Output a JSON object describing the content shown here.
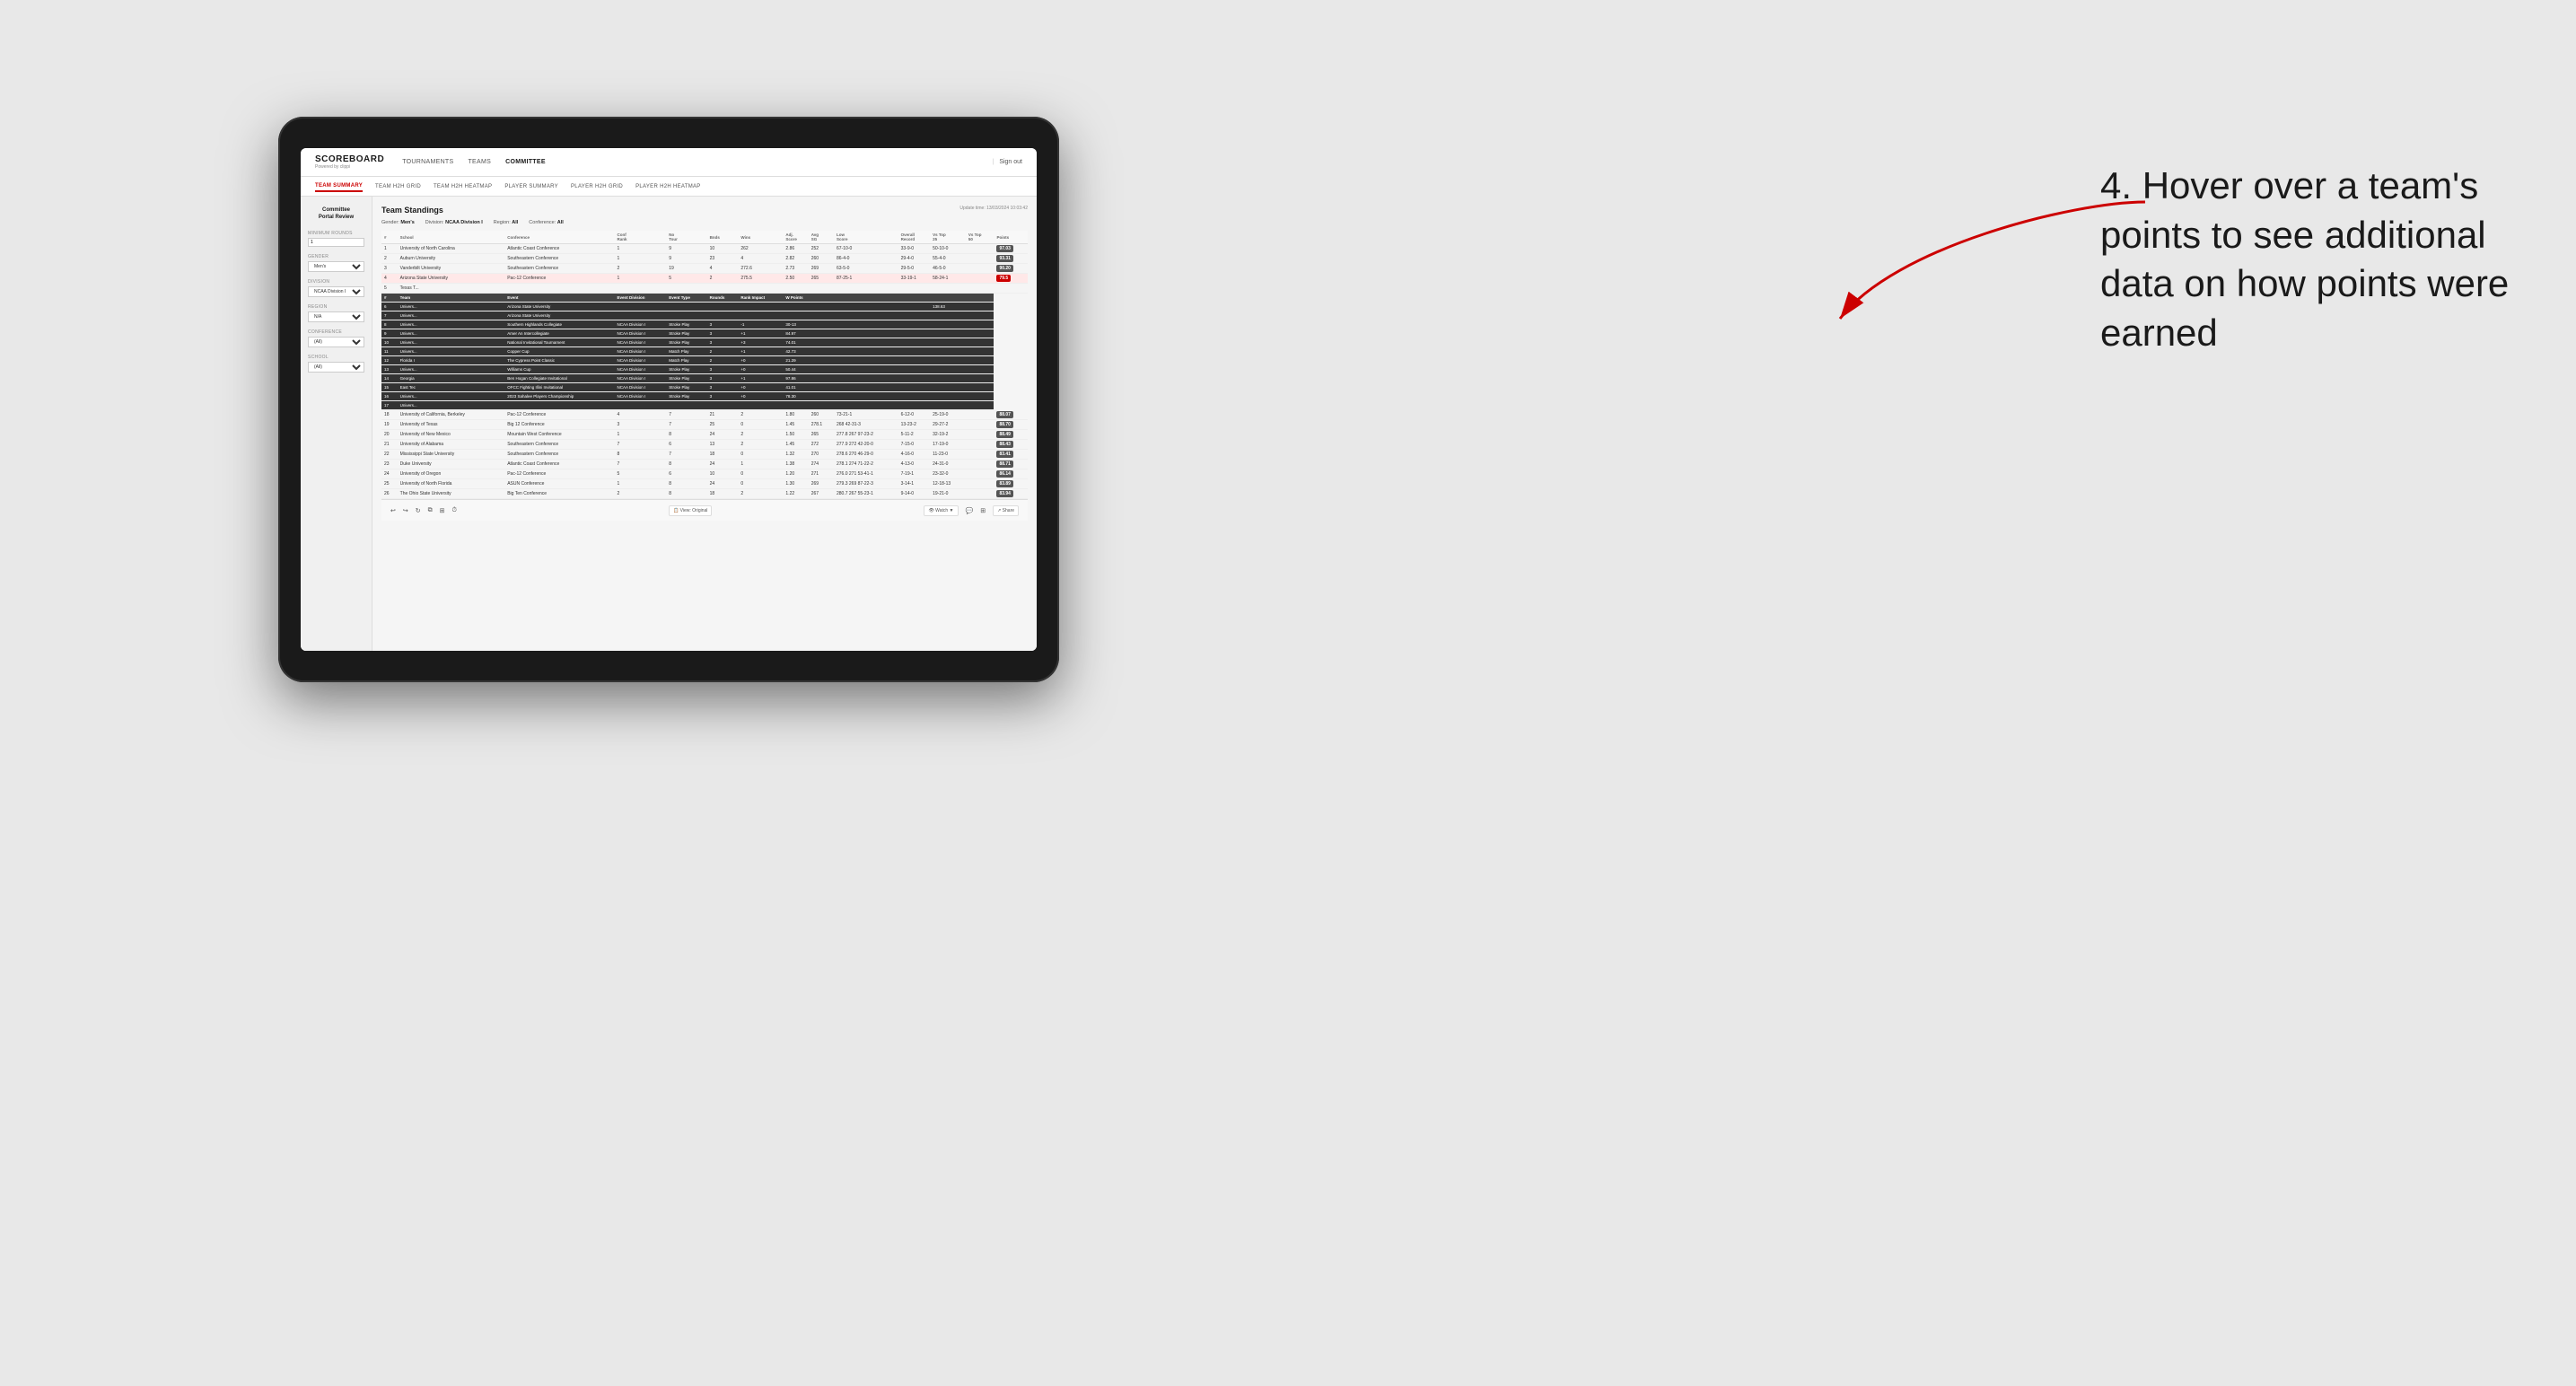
{
  "background": "#e8e8e8",
  "annotation": {
    "text": "4. Hover over a team's points to see additional data on how points were earned"
  },
  "app": {
    "logo": "SCOREBOARD",
    "logo_sub": "Powered by clippi",
    "nav": [
      {
        "label": "TOURNAMENTS",
        "active": false
      },
      {
        "label": "TEAMS",
        "active": false
      },
      {
        "label": "COMMITTEE",
        "active": true
      }
    ],
    "sign_out": "Sign out"
  },
  "sub_nav": [
    {
      "label": "TEAM SUMMARY",
      "active": true
    },
    {
      "label": "TEAM H2H GRID",
      "active": false
    },
    {
      "label": "TEAM H2H HEATMAP",
      "active": false
    },
    {
      "label": "PLAYER SUMMARY",
      "active": false
    },
    {
      "label": "PLAYER H2H GRID",
      "active": false
    },
    {
      "label": "PLAYER H2H HEATMAP",
      "active": false
    }
  ],
  "sidebar": {
    "title": "Committee\nPortal Review",
    "sections": [
      {
        "label": "Minimum Rounds",
        "type": "input",
        "value": "1"
      },
      {
        "label": "Gender",
        "type": "select",
        "value": "Men's"
      },
      {
        "label": "Division",
        "type": "select",
        "value": "NCAA Division I"
      },
      {
        "label": "Region",
        "type": "select",
        "value": "N/A"
      },
      {
        "label": "Conference",
        "type": "select",
        "value": "(All)"
      },
      {
        "label": "School",
        "type": "select",
        "value": "(All)"
      }
    ]
  },
  "content": {
    "title": "Team Standings",
    "update_time": "Update time: 13/03/2024 10:03:42",
    "filters": {
      "gender": "Men's",
      "division": "NCAA Division I",
      "region": "All",
      "conference": "All"
    },
    "table_headers": [
      "#",
      "School",
      "Conference",
      "Conf Rank",
      "No Tour",
      "Bnds Wins",
      "Adj Score",
      "Avg SG",
      "Low Score",
      "Overall Record",
      "Vs Top 25",
      "Vs Top 50",
      "Points"
    ],
    "tooltip_headers": [
      "#",
      "Team",
      "Event",
      "Event Division",
      "Event Type",
      "Rounds",
      "Rank Impact",
      "W Points"
    ],
    "teams": [
      {
        "rank": 1,
        "school": "University of North Carolina",
        "conference": "Atlantic Coast Conference",
        "conf_rank": 1,
        "no_tour": 9,
        "bnds": 10,
        "wins": 262,
        "adj_score": 2.86,
        "avg_sg": 252,
        "low": "67-10-0",
        "overall": "33-9-0",
        "vs25": "50-10-0",
        "vs50": "97.03",
        "points": "97.03",
        "highlighted": false
      },
      {
        "rank": 2,
        "school": "Auburn University",
        "conference": "Southeastern Conference",
        "conf_rank": 1,
        "no_tour": 9,
        "bnds": 23,
        "wins": 4,
        "adj_score": 2.82,
        "avg_sg": 260,
        "low": "86-4-0",
        "overall": "29-4-0",
        "vs25": "55-4-0",
        "vs50": "93.31",
        "points": "93.31",
        "highlighted": false
      },
      {
        "rank": 3,
        "school": "Vanderbilt University",
        "conference": "Southeastern Conference",
        "conf_rank": 2,
        "no_tour": 19,
        "bnds": 4,
        "wins": 272.6,
        "adj_score": 2.73,
        "avg_sg": 269,
        "low": "63-5-0",
        "overall": "29-5-0",
        "vs25": "46-5-0",
        "vs50": "90.20",
        "points": "90.20",
        "highlighted": false
      },
      {
        "rank": 4,
        "school": "Arizona State University",
        "conference": "Pac-12 Conference",
        "conf_rank": 1,
        "no_tour": 5,
        "bnds": 2,
        "wins": 275.5,
        "adj_score": 2.5,
        "avg_sg": 265,
        "low": "87-25-1",
        "overall": "33-19-1",
        "vs25": "58-24-1",
        "vs50": "79.5",
        "points": "79.5",
        "highlighted": true
      },
      {
        "rank": 5,
        "school": "Texas T...",
        "conference": "",
        "conf_rank": "",
        "no_tour": "",
        "bnds": "",
        "wins": "",
        "adj_score": "",
        "avg_sg": "",
        "low": "",
        "overall": "",
        "vs25": "",
        "vs50": "",
        "points": "",
        "highlighted": false
      }
    ],
    "tooltip_rows": [
      {
        "rank": 6,
        "team": "Univers...",
        "event": "Arizona State University",
        "event_division": "",
        "event_type": "",
        "rounds": "",
        "rank_impact": "",
        "w_points": ""
      },
      {
        "rank": 7,
        "team": "Univers...",
        "event": "Arizona State University",
        "event_division": "",
        "event_type": "",
        "rounds": "",
        "rank_impact": "",
        "w_points": ""
      },
      {
        "rank": 8,
        "team": "Univers...",
        "event": "Southern Highlands Collegiate",
        "event_division": "NCAA Division I",
        "event_type": "Stroke Play",
        "rounds": "3",
        "rank_impact": "-1",
        "w_points": "30-13"
      },
      {
        "rank": 9,
        "team": "Univers...",
        "event": "Amer An Intercollegiate",
        "event_division": "NCAA Division I",
        "event_type": "Stroke Play",
        "rounds": "3",
        "rank_impact": "+1",
        "w_points": "84.97"
      },
      {
        "rank": 10,
        "team": "Univers...",
        "event": "National Invitational Tournament",
        "event_division": "NCAA Division I",
        "event_type": "Stroke Play",
        "rounds": "3",
        "rank_impact": "+3",
        "w_points": "74.01"
      },
      {
        "rank": 11,
        "team": "Univers...",
        "event": "Copper Cup",
        "event_division": "NCAA Division I",
        "event_type": "Match Play",
        "rounds": "2",
        "rank_impact": "+1",
        "w_points": "42.73"
      },
      {
        "rank": 12,
        "team": "Florida I",
        "event": "The Cypress Point Classic",
        "event_division": "NCAA Division I",
        "event_type": "Match Play",
        "rounds": "2",
        "rank_impact": "+0",
        "w_points": "21.29"
      },
      {
        "rank": 13,
        "team": "Univers...",
        "event": "Williams Cup",
        "event_division": "NCAA Division I",
        "event_type": "Stroke Play",
        "rounds": "3",
        "rank_impact": "+0",
        "w_points": "50.44"
      },
      {
        "rank": 14,
        "team": "Georgia",
        "event": "Ben Hogan Collegiate Invitational",
        "event_division": "NCAA Division I",
        "event_type": "Stroke Play",
        "rounds": "3",
        "rank_impact": "+1",
        "w_points": "97.86"
      },
      {
        "rank": 15,
        "team": "East Tec",
        "event": "OFCC Fighting Illini Invitational",
        "event_division": "NCAA Division I",
        "event_type": "Stroke Play",
        "rounds": "3",
        "rank_impact": "+0",
        "w_points": "41.01"
      },
      {
        "rank": 16,
        "team": "Univers...",
        "event": "2023 Sahalee Players Championship",
        "event_division": "NCAA Division I",
        "event_type": "Stroke Play",
        "rounds": "3",
        "rank_impact": "+0",
        "w_points": "78.30"
      },
      {
        "rank": 17,
        "team": "Univers...",
        "event": "",
        "event_division": "",
        "event_type": "",
        "rounds": "",
        "rank_impact": "",
        "w_points": ""
      }
    ],
    "lower_teams": [
      {
        "rank": 18,
        "school": "University of California, Berkeley",
        "conference": "Pac-12 Conference",
        "conf_rank": 4,
        "no_tour": 7,
        "bnds": 21,
        "wins": 2,
        "adj_score": 1.8,
        "avg_sg": 260,
        "low": "73-21-1",
        "overall": "6-12-0",
        "vs25": "25-19-0",
        "vs50": "88.07"
      },
      {
        "rank": 19,
        "school": "University of Texas",
        "conference": "Big 12 Conference",
        "conf_rank": 3,
        "no_tour": 7,
        "bnds": 25,
        "wins": 0,
        "adj_score": 1.45,
        "avg_sg": 278.1,
        "low": "268 42-31-3",
        "overall": "13-23-2",
        "vs25": "29-27-2",
        "vs50": "88.70"
      },
      {
        "rank": 20,
        "school": "University of New Mexico",
        "conference": "Mountain West Conference",
        "conf_rank": 1,
        "no_tour": 8,
        "bnds": 24,
        "wins": 2,
        "adj_score": 1.5,
        "avg_sg": 265,
        "low": "277.8 267 97-23-2",
        "overall": "5-11-2",
        "vs25": "32-19-2",
        "vs50": "88.49"
      },
      {
        "rank": 21,
        "school": "University of Alabama",
        "conference": "Southeastern Conference",
        "conf_rank": 7,
        "no_tour": 6,
        "bnds": 13,
        "wins": 2,
        "adj_score": 1.45,
        "avg_sg": 272,
        "low": "277.9 272 42-20-0",
        "overall": "7-15-0",
        "vs25": "17-19-0",
        "vs50": "88.43"
      },
      {
        "rank": 22,
        "school": "Mississippi State University",
        "conference": "Southeastern Conference",
        "conf_rank": 8,
        "no_tour": 7,
        "bnds": 18,
        "wins": 0,
        "adj_score": 1.32,
        "avg_sg": 270,
        "low": "278.6 270 46-29-0",
        "overall": "4-16-0",
        "vs25": "11-23-0",
        "vs50": "83.41"
      },
      {
        "rank": 23,
        "school": "Duke University",
        "conference": "Atlantic Coast Conference",
        "conf_rank": 7,
        "no_tour": 8,
        "bnds": 24,
        "wins": 1,
        "adj_score": 1.38,
        "avg_sg": 274,
        "low": "278.1 274 71-22-2",
        "overall": "4-13-0",
        "vs25": "24-31-0",
        "vs50": "88.71"
      },
      {
        "rank": 24,
        "school": "University of Oregon",
        "conference": "Pac-12 Conference",
        "conf_rank": 5,
        "no_tour": 6,
        "bnds": 10,
        "wins": 0,
        "adj_score": 1.2,
        "avg_sg": 271,
        "low": "276.0 271 53-41-1",
        "overall": "7-19-1",
        "vs25": "23-32-0",
        "vs50": "86.14"
      },
      {
        "rank": 25,
        "school": "University of North Florida",
        "conference": "ASUN Conference",
        "conf_rank": 1,
        "no_tour": 8,
        "bnds": 24,
        "wins": 0,
        "adj_score": 1.3,
        "avg_sg": 269,
        "low": "279.3 269 87-22-3",
        "overall": "3-14-1",
        "vs25": "12-18-13",
        "vs50": "83.89"
      },
      {
        "rank": 26,
        "school": "The Ohio State University",
        "conference": "Big Ten Conference",
        "conf_rank": 2,
        "no_tour": 8,
        "bnds": 18,
        "wins": 2,
        "adj_score": 1.22,
        "avg_sg": 267,
        "low": "280.7 267 55-23-1",
        "overall": "9-14-0",
        "vs25": "19-21-0",
        "vs50": "83.94"
      }
    ]
  },
  "toolbar": {
    "view_label": "View: Original",
    "watch_label": "Watch",
    "share_label": "Share"
  }
}
